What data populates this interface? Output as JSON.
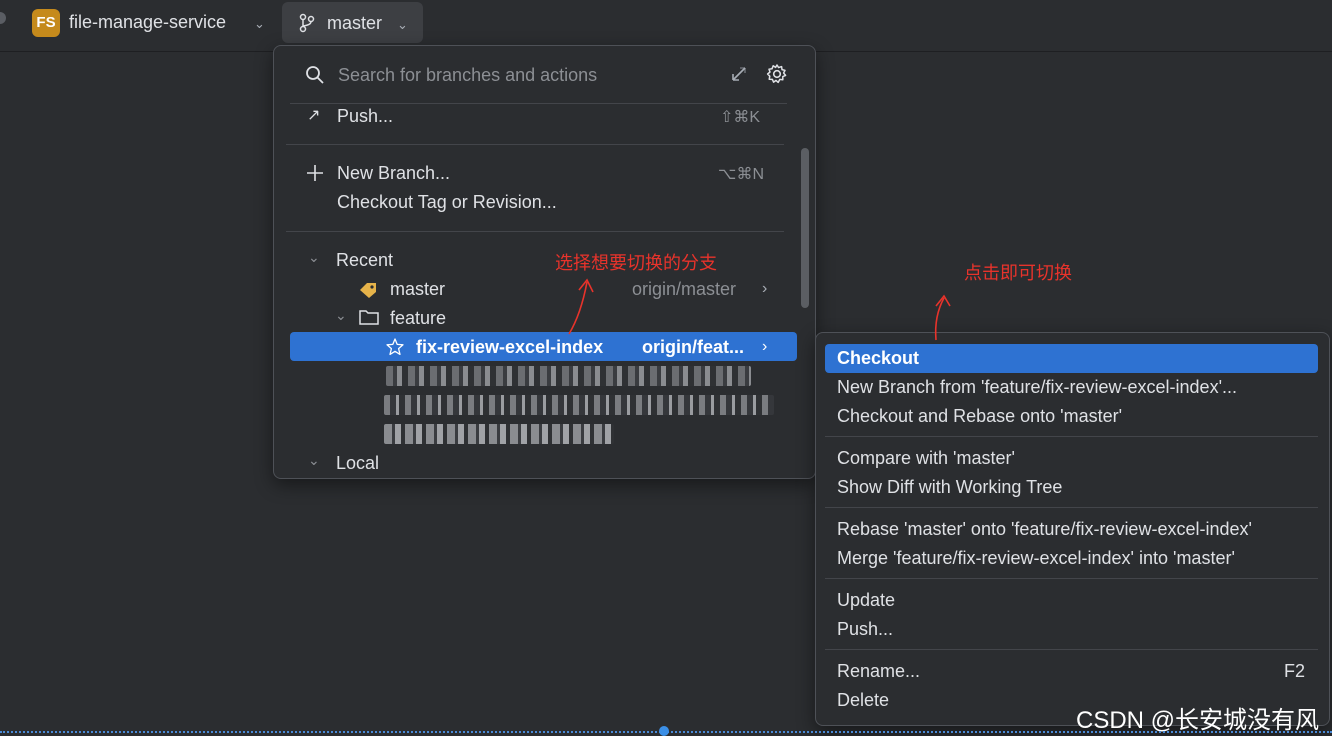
{
  "toolbar": {
    "project_badge": "FS",
    "project_name": "file-manage-service",
    "branch_name": "master"
  },
  "popup": {
    "search_placeholder": "Search for branches and actions",
    "actions": [
      {
        "label": "Push...",
        "shortcut": "⇧⌘K"
      },
      {
        "label": "New Branch...",
        "shortcut": "⌥⌘N"
      },
      {
        "label": "Checkout Tag or Revision...",
        "shortcut": ""
      }
    ],
    "recent_header": "Recent",
    "recent_master": {
      "label": "master",
      "remote": "origin/master"
    },
    "group_feature": "feature",
    "selected_branch": {
      "label": "fix-review-excel-index",
      "remote": "origin/feat..."
    },
    "local_header": "Local"
  },
  "submenu": {
    "items": [
      {
        "label": "Checkout"
      },
      {
        "label": "New Branch from 'feature/fix-review-excel-index'..."
      },
      {
        "label": "Checkout and Rebase onto 'master'"
      },
      {
        "label": "Compare with 'master'"
      },
      {
        "label": "Show Diff with Working Tree"
      },
      {
        "label": "Rebase 'master' onto 'feature/fix-review-excel-index'"
      },
      {
        "label": "Merge 'feature/fix-review-excel-index' into 'master'"
      },
      {
        "label": "Update"
      },
      {
        "label": "Push..."
      },
      {
        "label": "Rename...",
        "shortcut": "F2"
      },
      {
        "label": "Delete"
      }
    ]
  },
  "annotations": {
    "select_branch": "选择想要切换的分支",
    "click_to_switch": "点击即可切换"
  },
  "watermark": "CSDN @长安城没有风",
  "colors": {
    "background": "#2b2d30",
    "selection": "#2e72d2",
    "annotation": "#e8332b",
    "badge": "#c58a1c"
  }
}
